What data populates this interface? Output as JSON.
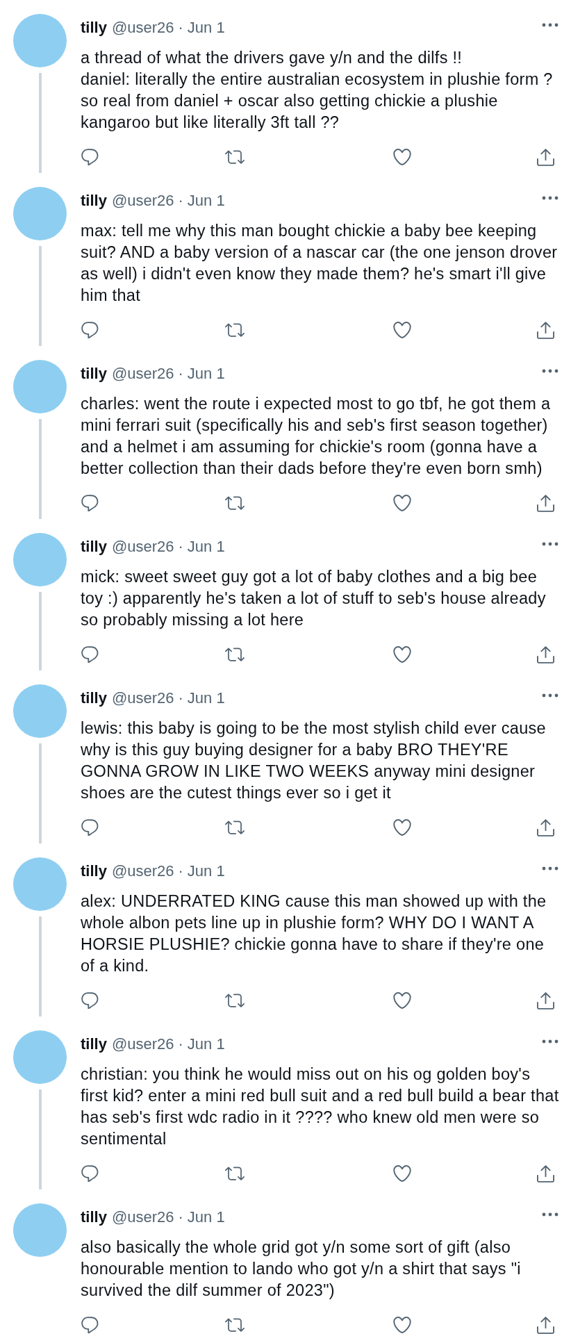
{
  "thread": {
    "tweets": [
      {
        "author": {
          "name": "tilly",
          "handle": "@user26"
        },
        "separator": "·",
        "date": "Jun 1",
        "text": "a thread of what the drivers gave y/n and the dilfs !!\ndaniel: literally the entire australian ecosystem in plushie form ? so real from daniel + oscar also getting chickie a plushie kangaroo but like literally 3ft tall ??",
        "connected": true
      },
      {
        "author": {
          "name": "tilly",
          "handle": "@user26"
        },
        "separator": "·",
        "date": "Jun 1",
        "text": "max: tell me why this man bought chickie a baby bee keeping suit? AND a baby version of a nascar car (the one jenson drover as well) i didn't even know they made them? he's smart i'll give him that",
        "connected": true
      },
      {
        "author": {
          "name": "tilly",
          "handle": "@user26"
        },
        "separator": "·",
        "date": "Jun 1",
        "text": "charles: went the route i expected most to go tbf, he got them a mini ferrari suit (specifically his and seb's first season together) and a helmet i am assuming for chickie's room (gonna have a better collection than their dads before they're even born smh)",
        "connected": true
      },
      {
        "author": {
          "name": "tilly",
          "handle": "@user26"
        },
        "separator": "·",
        "date": "Jun 1",
        "text": "mick: sweet sweet guy got a lot of baby clothes and a big bee toy :) apparently he's taken a lot of stuff to seb's house already so probably missing a lot here",
        "connected": true
      },
      {
        "author": {
          "name": "tilly",
          "handle": "@user26"
        },
        "separator": "·",
        "date": "Jun 1",
        "text": "lewis: this baby is going to be the most stylish child ever cause why is this guy buying designer for a baby BRO THEY'RE GONNA GROW IN LIKE TWO WEEKS anyway mini designer shoes are the cutest things ever so i get it",
        "connected": true
      },
      {
        "author": {
          "name": "tilly",
          "handle": "@user26"
        },
        "separator": "·",
        "date": "Jun 1",
        "text": "alex: UNDERRATED KING cause this man showed up with the whole albon pets line up in plushie form? WHY DO I WANT A HORSIE PLUSHIE? chickie gonna have to share if they're one of a kind.",
        "connected": true
      },
      {
        "author": {
          "name": "tilly",
          "handle": "@user26"
        },
        "separator": "·",
        "date": "Jun 1",
        "text": "christian: you think he would miss out on his og golden boy's first kid? enter a mini red bull suit and a red bull build a bear that has seb's first wdc radio in it ???? who knew old men were so sentimental",
        "connected": true
      },
      {
        "author": {
          "name": "tilly",
          "handle": "@user26"
        },
        "separator": "·",
        "date": "Jun 1",
        "text": "also basically the whole grid got y/n some sort of gift (also honourable mention to lando who got y/n a shirt that says \"i survived the dilf summer of 2023\")",
        "connected": false
      }
    ]
  }
}
